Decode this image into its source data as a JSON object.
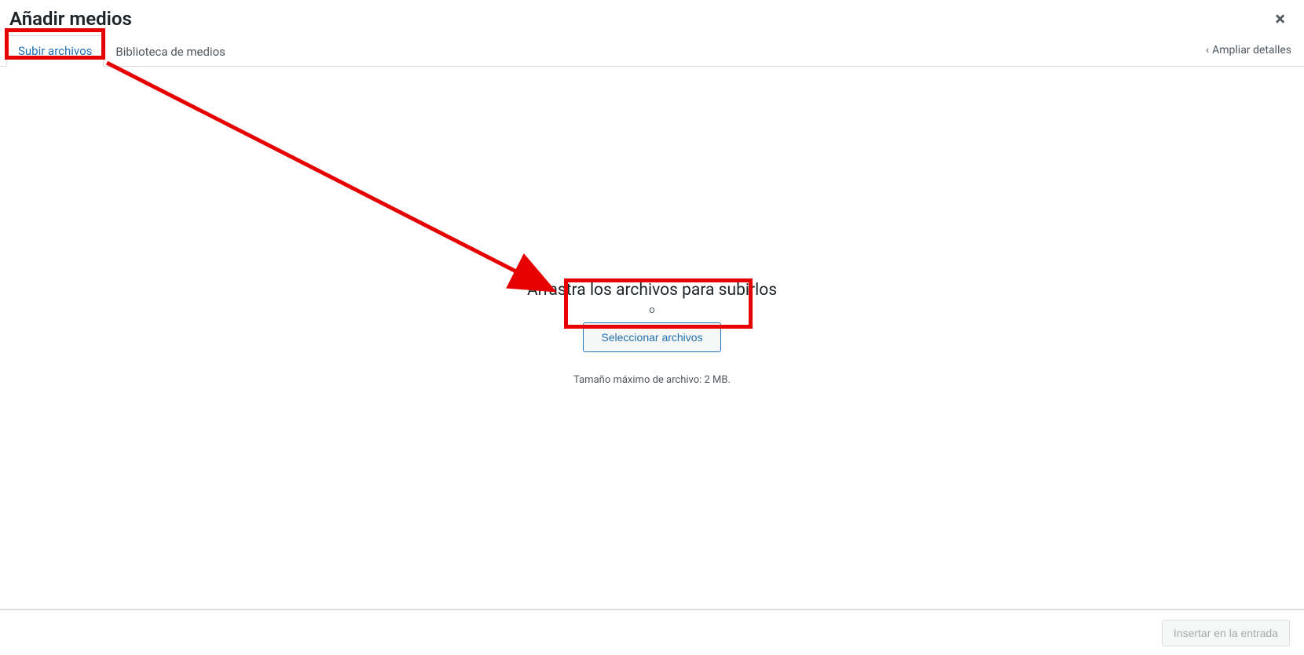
{
  "modal": {
    "title": "Añadir medios",
    "close_label": "×"
  },
  "tabs": {
    "upload": "Subir archivos",
    "library": "Biblioteca de medios",
    "expand": "Ampliar detalles"
  },
  "upload": {
    "heading": "Arrastra los archivos para subirlos",
    "or": "o",
    "select_button": "Seleccionar archivos",
    "max_size": "Tamaño máximo de archivo: 2 MB."
  },
  "footer": {
    "insert_button": "Insertar en la entrada"
  }
}
